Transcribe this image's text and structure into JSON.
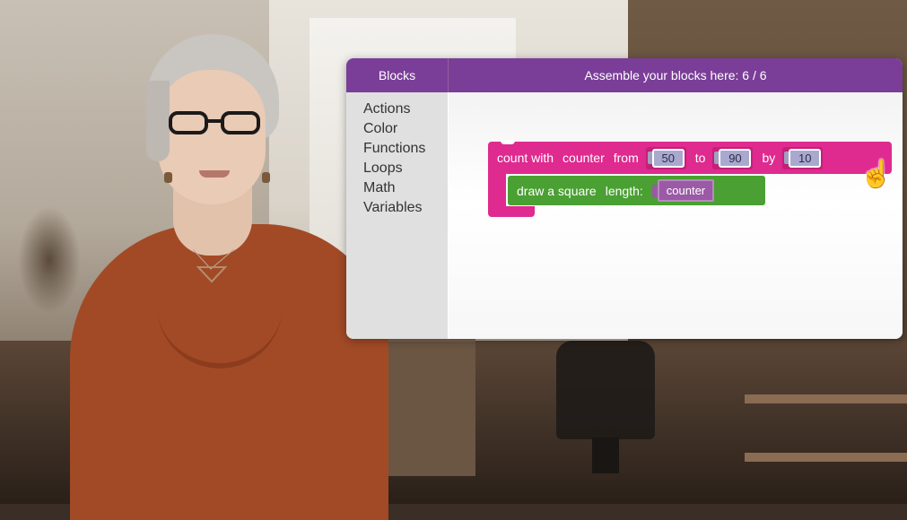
{
  "panel": {
    "header": {
      "blocks_label": "Blocks",
      "assemble_label": "Assemble your blocks here: 6 / 6"
    },
    "toolbox": {
      "categories": [
        "Actions",
        "Color",
        "Functions",
        "Loops",
        "Math",
        "Variables"
      ]
    },
    "workspace": {
      "loop_block": {
        "words": [
          "count with",
          "counter",
          "from",
          "to",
          "by"
        ],
        "from_value": "50",
        "to_value": "90",
        "by_value": "10"
      },
      "draw_block": {
        "label": "draw a square",
        "length_label": "length:",
        "length_var": "counter"
      }
    }
  },
  "colors": {
    "header": "#7a3e98",
    "loop_block": "#df2a8f",
    "draw_block": "#4aa032",
    "variable": "#9a5aa5",
    "toolbox": "#e0e0e0",
    "presenter_top": "#a24a26"
  },
  "icons": {
    "cursor": "hand-pointer-icon"
  }
}
